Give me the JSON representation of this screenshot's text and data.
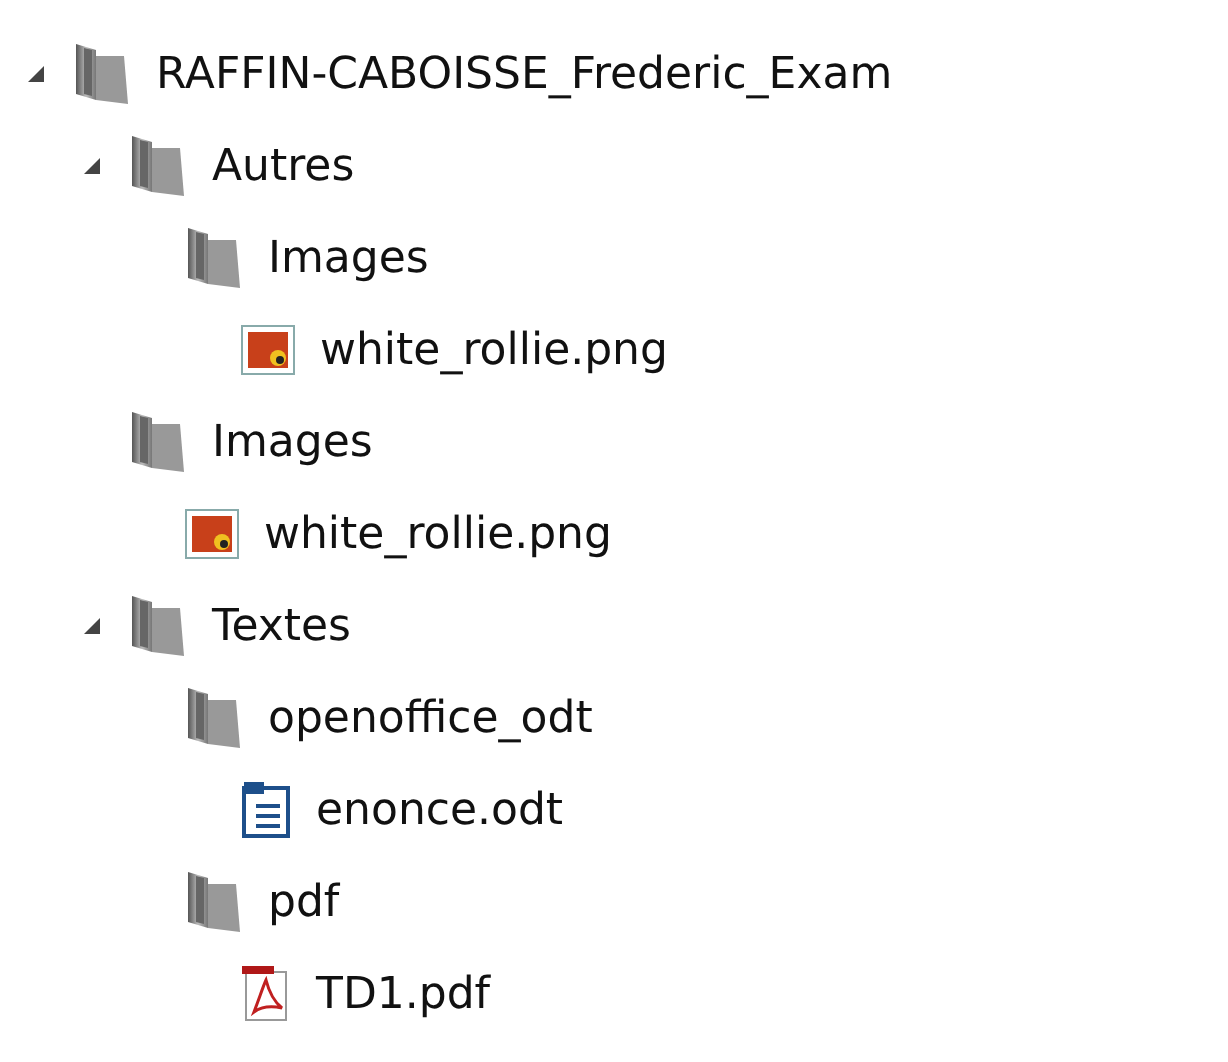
{
  "tree": [
    {
      "label": "RAFFIN-CABOISSE_Frederic_Exam",
      "kind": "folder",
      "expanded": true,
      "children": [
        {
          "label": "Autres",
          "kind": "folder",
          "expanded": true,
          "children": [
            {
              "label": "Images",
              "kind": "folder",
              "children": [
                {
                  "label": "white_rollie.png",
                  "kind": "image"
                }
              ]
            }
          ]
        },
        {
          "label": "Images",
          "kind": "folder",
          "children": [
            {
              "label": "white_rollie.png",
              "kind": "image"
            }
          ]
        },
        {
          "label": "Textes",
          "kind": "folder",
          "expanded": true,
          "children": [
            {
              "label": "openoffice_odt",
              "kind": "folder",
              "children": [
                {
                  "label": "enonce.odt",
                  "kind": "document"
                }
              ]
            },
            {
              "label": "pdf",
              "kind": "folder",
              "children": [
                {
                  "label": "TD1.pdf",
                  "kind": "pdf"
                }
              ]
            }
          ]
        }
      ]
    }
  ]
}
